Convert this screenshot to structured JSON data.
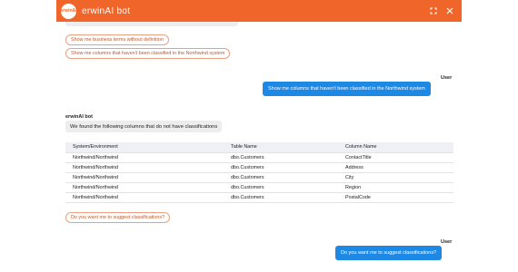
{
  "header": {
    "logo_text": "erwinAI",
    "title": "erwinAI bot",
    "icons": [
      "expand-icon",
      "close-icon"
    ],
    "accent_color": "#f0662a"
  },
  "suggestions_top": [
    "Show me business terms without definition",
    "Show me columns that haven't been classified in the Northwind system"
  ],
  "user_message_1": {
    "label": "User",
    "text": "Show me columns that haven't been classified in the Northwind system"
  },
  "bot_message": {
    "label": "erwinAI bot",
    "text": "We found the following columns that do not have classifications"
  },
  "table": {
    "headers": [
      "System/Environment",
      "Table Name",
      "Column Name"
    ],
    "rows": [
      [
        "Northwind/Northwind",
        "dbo.Customers",
        "ContactTitle"
      ],
      [
        "Northwind/Northwind",
        "dbo.Customers",
        "Address"
      ],
      [
        "Northwind/Northwind",
        "dbo.Customers",
        "City"
      ],
      [
        "Northwind/Northwind",
        "dbo.Customers",
        "Region"
      ],
      [
        "Northwind/Northwind",
        "dbo.Customers",
        "PostalCode"
      ]
    ]
  },
  "suggestion_bottom": "Do you want me to suggest classifications?",
  "user_message_2": {
    "label": "User",
    "text": "Do you want me to suggest classifications?"
  }
}
